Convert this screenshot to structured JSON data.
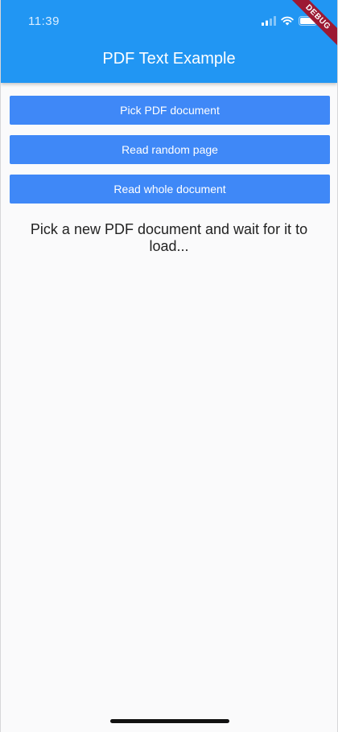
{
  "status_bar": {
    "time": "11:39",
    "icons": [
      "cellular-signal-icon",
      "wifi-icon",
      "battery-icon"
    ]
  },
  "app_bar": {
    "title": "PDF Text Example",
    "color": "#2196f3"
  },
  "debug_banner": {
    "label": "DEBUG",
    "color": "#9c1933"
  },
  "buttons": {
    "pick": "Pick PDF document",
    "random": "Read random page",
    "whole": "Read whole document",
    "color": "#3f88f7"
  },
  "message": "Pick a new PDF document and wait for it to load..."
}
